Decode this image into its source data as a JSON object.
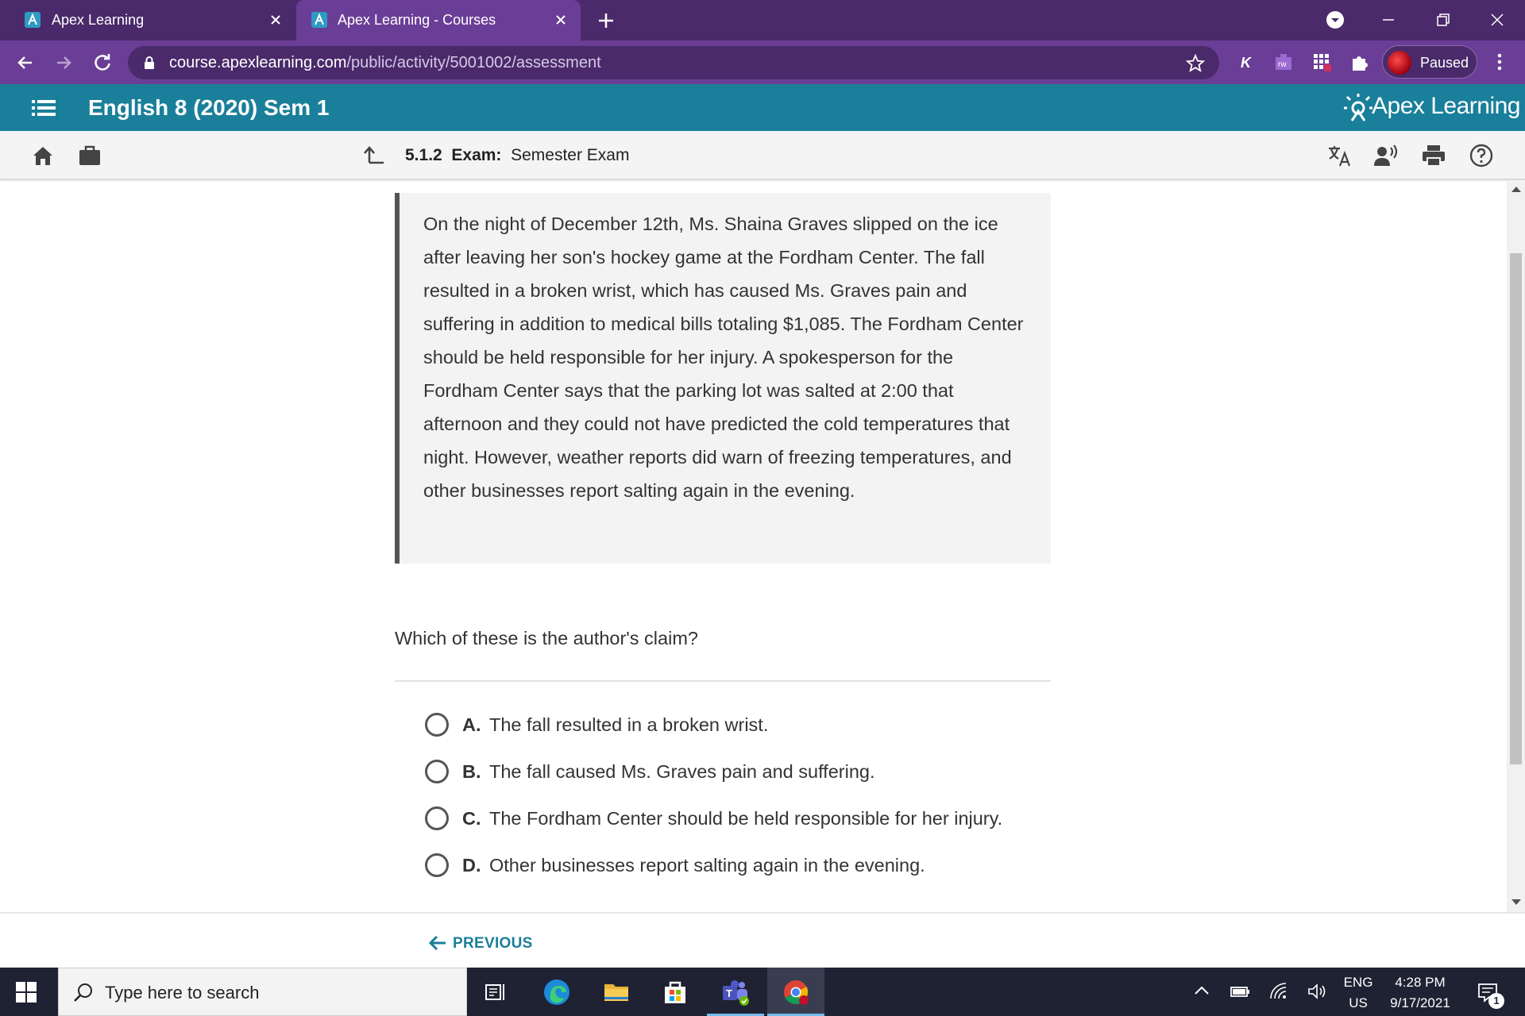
{
  "browser": {
    "tabs": [
      {
        "title": "Apex Learning",
        "active": false
      },
      {
        "title": "Apex Learning - Courses",
        "active": true
      }
    ],
    "url_host": "course.apexlearning.com",
    "url_path": "/public/activity/5001002/assessment",
    "profile_label": "Paused",
    "extensions": [
      "k-extension-icon",
      "rw-extension-icon",
      "grid-extension-icon",
      "puzzle-extensions-icon"
    ]
  },
  "app": {
    "course_title": "English 8 (2020) Sem 1",
    "logo_text": "Apex Learning",
    "brand_color": "#1a7f9a"
  },
  "subnav": {
    "section_number": "5.1.2",
    "activity_type": "Exam:",
    "activity_title": "Semester Exam"
  },
  "passage": {
    "text": "On the night of December 12th, Ms. Shaina Graves slipped on the ice after leaving her son's hockey game at the Fordham Center. The fall resulted in a broken wrist, which has caused Ms. Graves pain and suffering in addition to medical bills totaling $1,085. The Fordham Center should be held responsible for her injury. A spokesperson for the Fordham Center says that the parking lot was salted at 2:00 that afternoon and they could not have predicted the cold temperatures that night. However, weather reports did warn of freezing temperatures, and other businesses report salting again in the evening."
  },
  "question": {
    "prompt": "Which of these is the author's claim?",
    "options": [
      {
        "letter": "A.",
        "text": "The fall resulted in a broken wrist."
      },
      {
        "letter": "B.",
        "text": "The fall caused Ms. Graves pain and suffering."
      },
      {
        "letter": "C.",
        "text": "The Fordham Center should be held responsible for her injury."
      },
      {
        "letter": "D.",
        "text": "Other businesses report salting again in the evening."
      }
    ]
  },
  "footer": {
    "previous_label": "PREVIOUS"
  },
  "taskbar": {
    "search_placeholder": "Type here to search",
    "language_top": "ENG",
    "language_bottom": "US",
    "time": "4:28 PM",
    "date": "9/17/2021",
    "notification_count": "1"
  }
}
